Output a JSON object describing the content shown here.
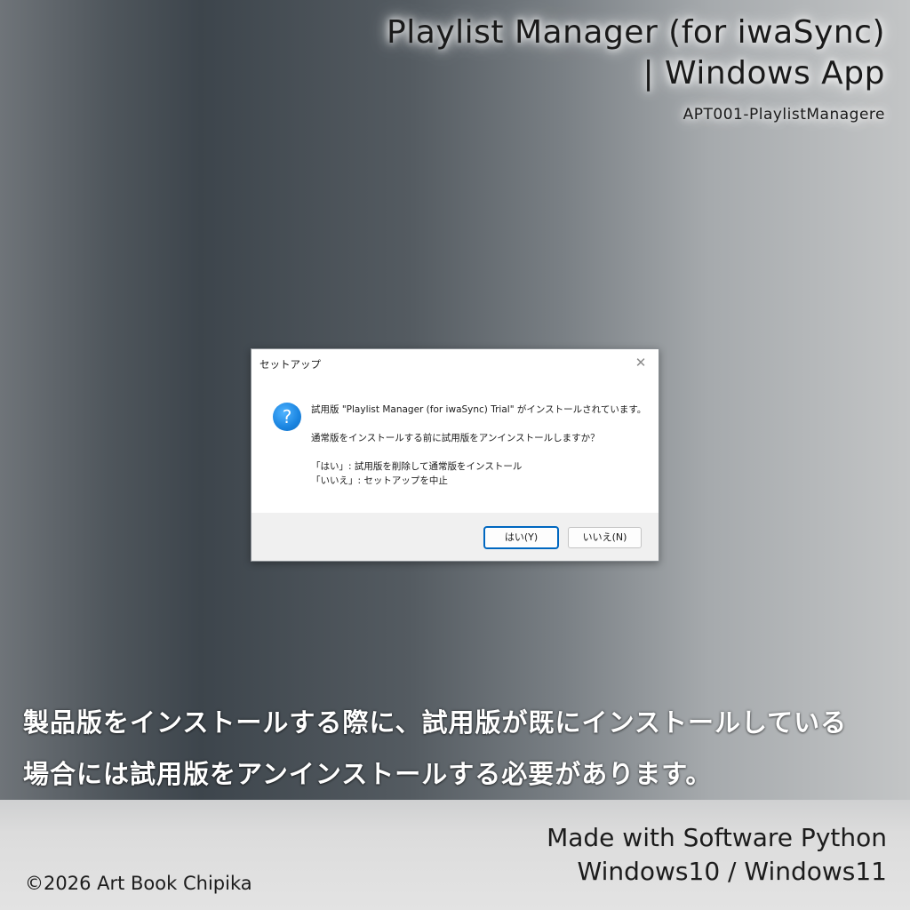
{
  "header": {
    "title_line1": "Playlist Manager (for iwaSync)",
    "title_line2": "| Windows App",
    "product_code": "APT001-PlaylistManagere"
  },
  "dialog": {
    "title": "セットアップ",
    "close_glyph": "✕",
    "icon": "question-icon",
    "icon_glyph": "?",
    "message_line1": "試用版 \"Playlist Manager (for iwaSync) Trial\" がインストールされています。",
    "message_line2": "通常版をインストールする前に試用版をアンインストールしますか？",
    "message_line3": "「はい」: 試用版を削除して通常版をインストール",
    "message_line4": "「いいえ」: セットアップを中止",
    "yes_label": "はい(Y)",
    "no_label": "いいえ(N)"
  },
  "caption": {
    "line1": "製品版をインストールする際に、試用版が既にインストールしている",
    "line2": "場合には試用版をアンインストールする必要があります。"
  },
  "footer": {
    "made_with_line1": "Made with Software Python",
    "made_with_line2": "Windows10 / Windows11",
    "copyright": "©2026 Art Book Chipika"
  },
  "colors": {
    "accent_button_border": "#0067c0",
    "question_icon": "#1a84e0"
  }
}
